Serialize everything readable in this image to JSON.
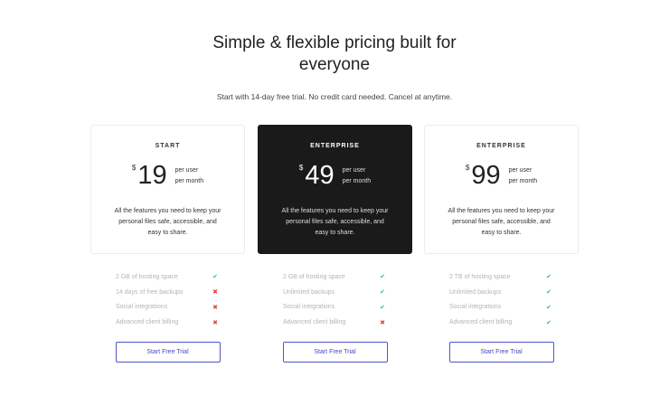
{
  "header": {
    "title": "Simple & flexible pricing built for everyone",
    "subtitle": "Start with 14-day free trial. No credit card needed. Cancel at anytime."
  },
  "colors": {
    "accent": "#3f4bc2",
    "check": "#2bbf8a",
    "cross": "#e5443c",
    "dark_card": "#1a1a1a"
  },
  "plans": [
    {
      "name": "START",
      "currency": "$",
      "price": "19",
      "per_user": "per user",
      "per_month": "per month",
      "description": "All the features you need to keep your personal files safe, accessible, and easy to share.",
      "features": [
        {
          "label": "2 GB of hosting space",
          "included": true,
          "icon": "check-icon"
        },
        {
          "label": "14 days of free backups",
          "included": false,
          "icon": "cross-icon"
        },
        {
          "label": "Social integrations",
          "included": false,
          "icon": "cross-icon"
        },
        {
          "label": "Advanced client billing",
          "included": false,
          "icon": "cross-icon"
        }
      ],
      "cta": "Start Free Trial"
    },
    {
      "name": "ENTERPRISE",
      "currency": "$",
      "price": "49",
      "per_user": "per user",
      "per_month": "per month",
      "description": "All the features you need to keep your personal files safe, accessible, and easy to share.",
      "features": [
        {
          "label": "2 GB of hosting space",
          "included": true,
          "icon": "check-icon"
        },
        {
          "label": "Unlimited backups",
          "included": true,
          "icon": "check-icon"
        },
        {
          "label": "Social integrations",
          "included": true,
          "icon": "check-icon"
        },
        {
          "label": "Advanced client billing",
          "included": false,
          "icon": "cross-icon"
        }
      ],
      "cta": "Start Free Trial"
    },
    {
      "name": "ENTERPRISE",
      "currency": "$",
      "price": "99",
      "per_user": "per user",
      "per_month": "per month",
      "description": "All the features you need to keep your personal files safe, accessible, and easy to share.",
      "features": [
        {
          "label": "2 TB of hosting space",
          "included": true,
          "icon": "check-icon"
        },
        {
          "label": "Unlimited backups",
          "included": true,
          "icon": "check-icon"
        },
        {
          "label": "Social integrations",
          "included": true,
          "icon": "check-icon"
        },
        {
          "label": "Advanced client billing",
          "included": true,
          "icon": "check-icon"
        }
      ],
      "cta": "Start Free Trial"
    }
  ]
}
